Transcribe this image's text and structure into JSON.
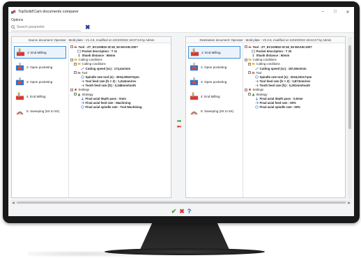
{
  "window": {
    "title": "TopSolid'Cam documents comparer",
    "minimize": "–",
    "maximize": "□",
    "close": "✕"
  },
  "menu": {
    "options": "Options"
  },
  "search": {
    "placeholder": "Search parameter"
  },
  "left": {
    "header": "Source document: Operator - Mold plate - V1.4.8, modified on 24/10/2022 18:37:24 by Admin",
    "operations": [
      {
        "label": "1: End Milling",
        "icon": "end-milling-icon"
      },
      {
        "label": "2: Open pocketing",
        "icon": "open-pocketing-icon"
      },
      {
        "label": "3: Open pocketing",
        "icon": "open-pocketing-icon"
      },
      {
        "label": "4: End Milling",
        "icon": "end-milling-icon"
      },
      {
        "label": "5: Sweeping (5X to 5X)",
        "icon": "sweeping-icon"
      }
    ],
    "tree": [
      {
        "text": "Tool : ZT_EC100832-3C18_50 MAXIN 200?",
        "indent": 0,
        "expander": "⊟",
        "icon": "tool-icon",
        "bold": true
      },
      {
        "text": "Pocket description : T 11",
        "indent": 1,
        "expander": "",
        "icon": "pocket-icon",
        "bold": true
      },
      {
        "text": "Shank distance : 65mm",
        "indent": 1,
        "expander": "",
        "icon": "shank-icon",
        "bold": true
      },
      {
        "text": "Cutting conditions",
        "indent": 0,
        "expander": "⊟",
        "icon": "conditions-icon",
        "bold": false
      },
      {
        "text": "Cutting conditions",
        "indent": 1,
        "expander": "⊟",
        "icon": "conditions-icon",
        "bold": false
      },
      {
        "text": "Cutting speed (vc) : 174,4m/min",
        "indent": 2,
        "expander": "",
        "icon": "speed-icon",
        "bold": true
      },
      {
        "text": "Tool",
        "indent": 1,
        "expander": "⊟",
        "icon": "tool-icon",
        "bold": false
      },
      {
        "text": "Spindle rate tool (n) : 3004,009473rpm",
        "indent": 2,
        "expander": "",
        "icon": "spindle-icon",
        "bold": true
      },
      {
        "text": "Tool feed rate (fz × Z) : 1,044mm/rev",
        "indent": 2,
        "expander": "",
        "icon": "feed-icon",
        "bold": true
      },
      {
        "text": "Tooth feed rate (fz) : 0,348mm/tooth",
        "indent": 2,
        "expander": "",
        "icon": "feed-icon",
        "bold": true
      },
      {
        "text": "Settings",
        "indent": 0,
        "expander": "⊟",
        "icon": "settings-icon",
        "bold": false
      },
      {
        "text": "Strategy",
        "indent": 1,
        "expander": "⊟",
        "icon": "strategy-icon",
        "bold": false
      },
      {
        "text": "Final axial depth pass : 0mm",
        "indent": 2,
        "expander": "",
        "icon": "depth-icon",
        "bold": true
      },
      {
        "text": "Final axial feed rate : Machining",
        "indent": 2,
        "expander": "",
        "icon": "feed-icon",
        "bold": true
      },
      {
        "text": "Final axial spindle rate : Tool Machining",
        "indent": 2,
        "expander": "",
        "icon": "spindle-icon",
        "bold": true
      }
    ]
  },
  "right": {
    "header": "Destination document: Operator - Mold plate - V2.4.5, modified on 24/10/2022 18:44:27 by Admin",
    "operations": [
      {
        "label": "1: End Milling",
        "icon": "end-milling-icon"
      },
      {
        "label": "2: Open pocketing",
        "icon": "open-pocketing-icon"
      },
      {
        "label": "3: Open pocketing",
        "icon": "open-pocketing-icon"
      },
      {
        "label": "4: End Milling",
        "icon": "end-milling-icon"
      },
      {
        "label": "5: Sweeping (5X to 5X)",
        "icon": "sweeping-icon"
      }
    ],
    "tree": [
      {
        "text": "Tool : ZT_EC100832-3C18_50 MAXIN 200?",
        "indent": 0,
        "expander": "⊟",
        "icon": "tool-icon",
        "bold": true
      },
      {
        "text": "Pocket description : T 20",
        "indent": 1,
        "expander": "",
        "icon": "pocket-icon",
        "bold": true
      },
      {
        "text": "Shank distance : 60mm",
        "indent": 1,
        "expander": "",
        "icon": "shank-icon",
        "bold": true
      },
      {
        "text": "Cutting conditions",
        "indent": 0,
        "expander": "⊟",
        "icon": "conditions-icon",
        "bold": false
      },
      {
        "text": "Cutting conditions",
        "indent": 1,
        "expander": "⊟",
        "icon": "conditions-icon",
        "bold": false
      },
      {
        "text": "Cutting speed (vc) : 187,55m/min",
        "indent": 2,
        "expander": "",
        "icon": "speed-icon",
        "bold": true
      },
      {
        "text": "Tool",
        "indent": 1,
        "expander": "⊟",
        "icon": "tool-icon",
        "bold": false
      },
      {
        "text": "Spindle rate tool (n) : 3316,03217rpm",
        "indent": 2,
        "expander": "",
        "icon": "spindle-icon",
        "bold": true
      },
      {
        "text": "Tool feed rate (fz × Z) : 0,873mm/rev",
        "indent": 2,
        "expander": "",
        "icon": "feed-icon",
        "bold": true
      },
      {
        "text": "Tooth feed rate (fz) : 0,291mm/tooth",
        "indent": 2,
        "expander": "",
        "icon": "feed-icon",
        "bold": true
      },
      {
        "text": "Settings",
        "indent": 0,
        "expander": "⊟",
        "icon": "settings-icon",
        "bold": false
      },
      {
        "text": "Strategy",
        "indent": 1,
        "expander": "⊟",
        "icon": "strategy-icon",
        "bold": false
      },
      {
        "text": "Final axial depth pass : 0,5mm",
        "indent": 2,
        "expander": "",
        "icon": "depth-icon",
        "bold": true
      },
      {
        "text": "Final axial feed rate : 50%",
        "indent": 2,
        "expander": "",
        "icon": "feed-icon",
        "bold": true
      },
      {
        "text": "Final axial spindle rate : 50%",
        "indent": 2,
        "expander": "",
        "icon": "spindle-icon",
        "bold": true
      }
    ]
  },
  "footer": {
    "ok": "✔",
    "cancel": "✖",
    "help": "?"
  },
  "colors": {
    "accent": "#3a8fd8",
    "ok": "#3b9c2c",
    "cancel": "#d0392b",
    "help": "#1e5bbf"
  }
}
